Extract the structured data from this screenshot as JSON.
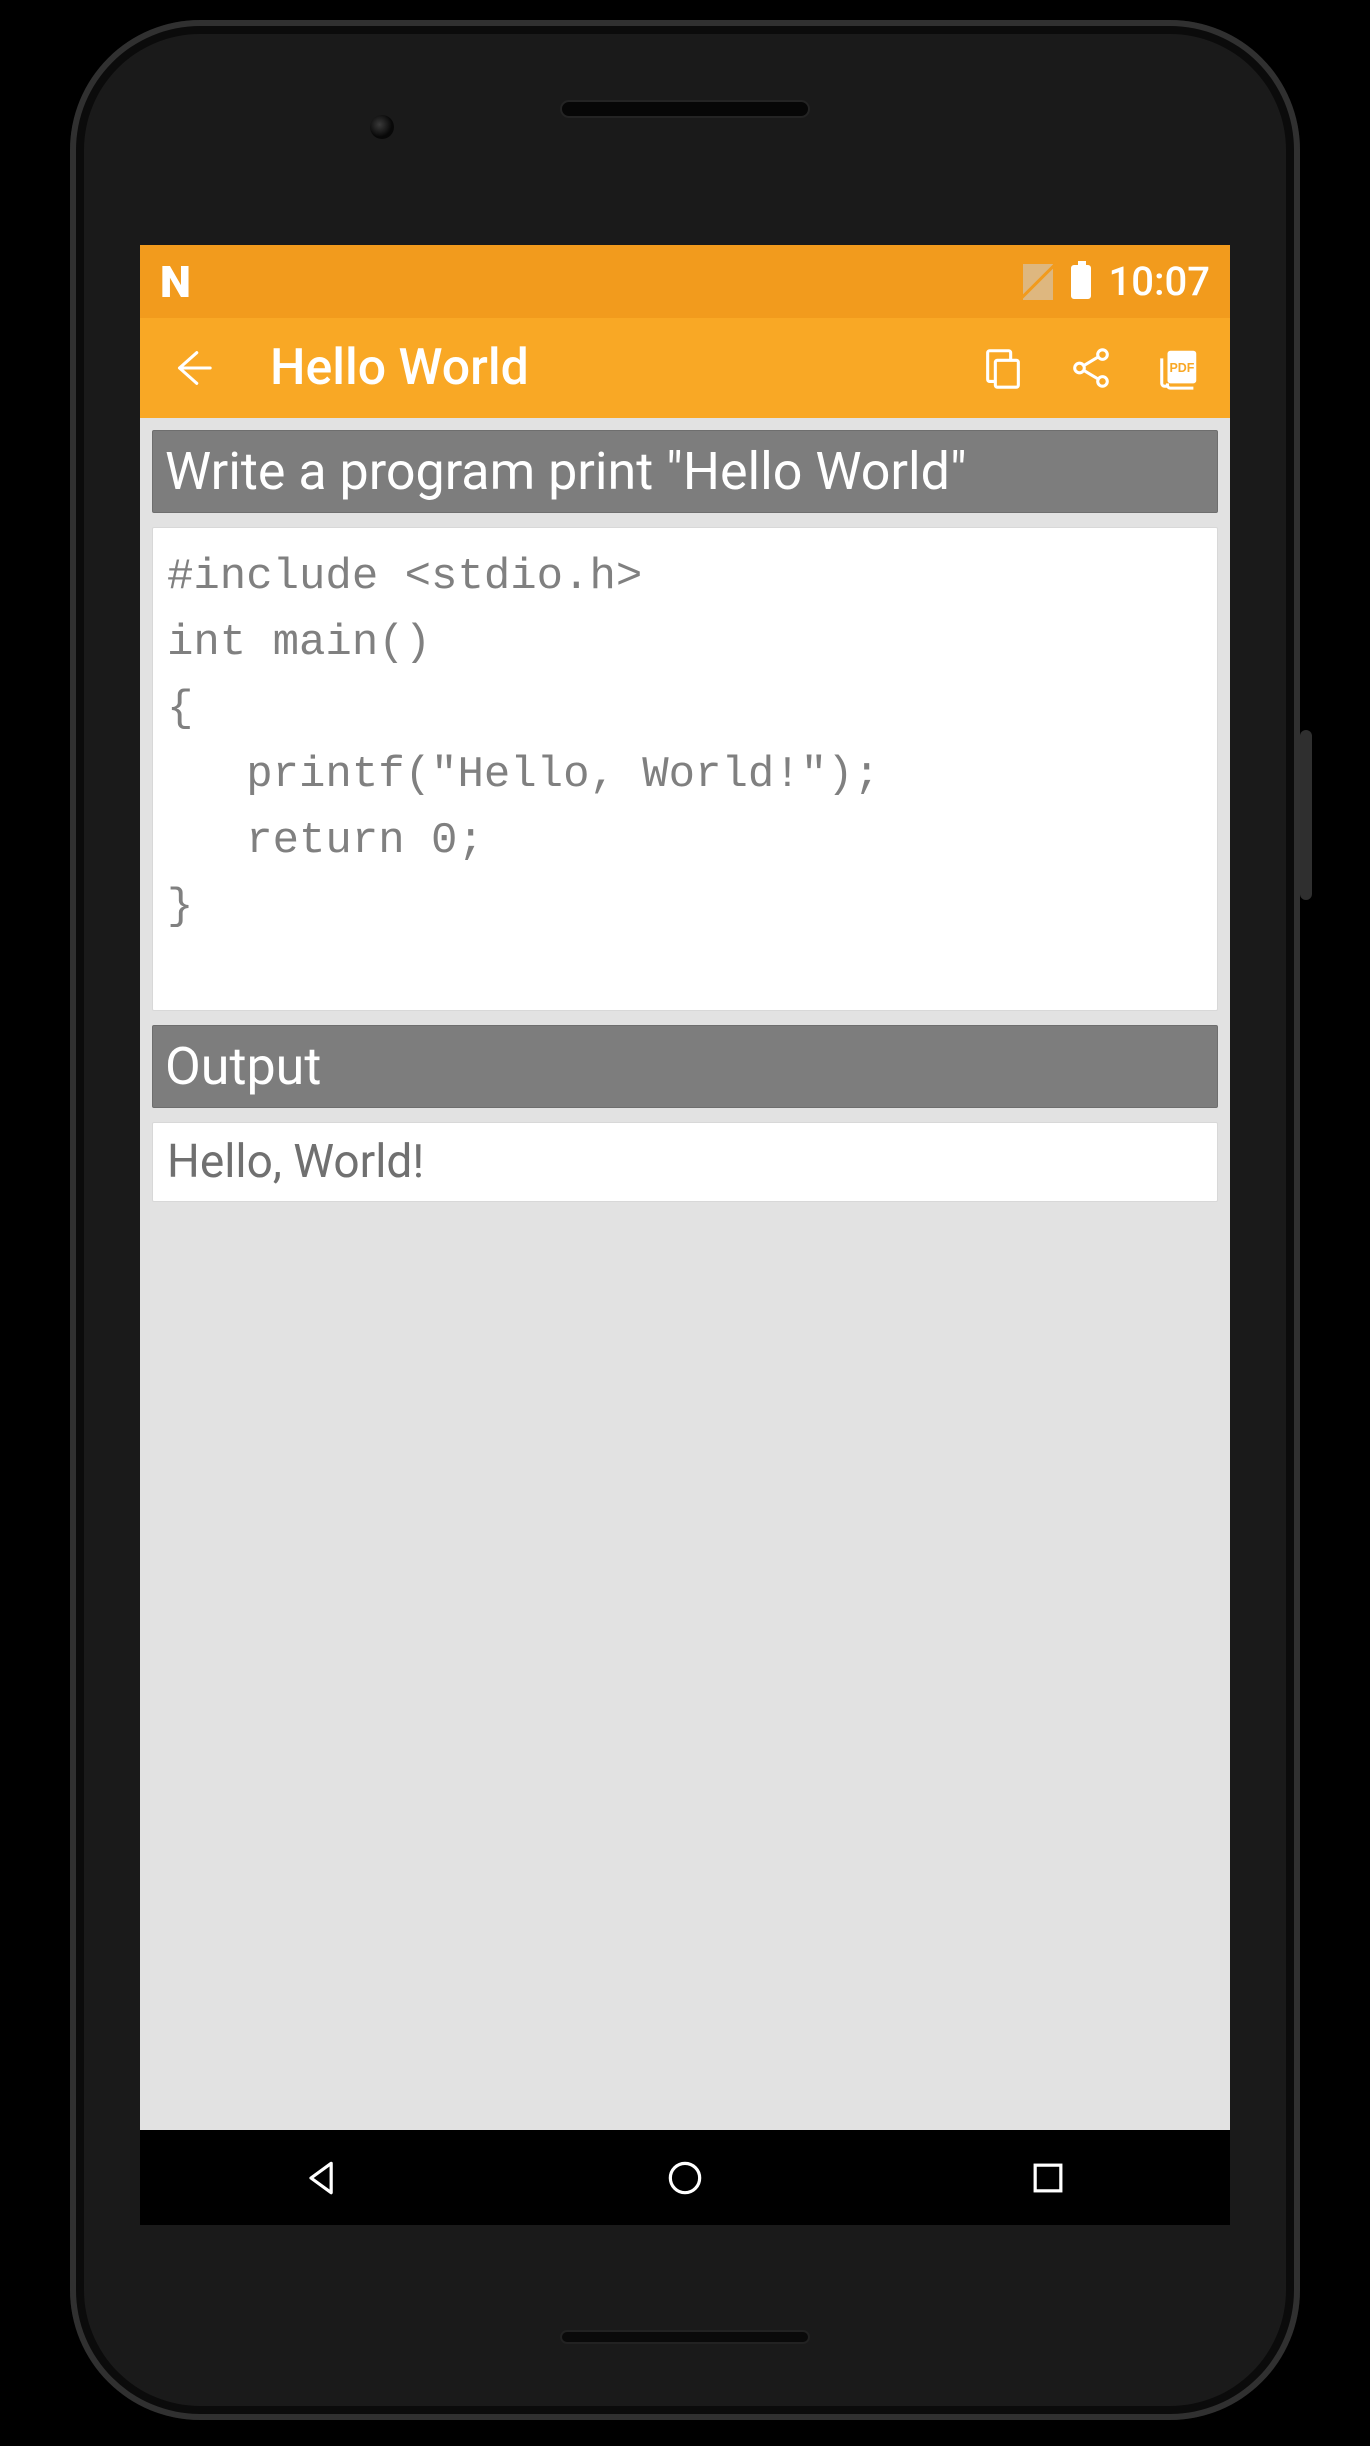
{
  "status": {
    "time": "10:07"
  },
  "appbar": {
    "title": "Hello World"
  },
  "problem": {
    "header": "Write a program print \"Hello World\"",
    "code": "#include <stdio.h>\nint main()\n{\n   printf(\"Hello, World!\");\n   return 0;\n}"
  },
  "output": {
    "header": "Output",
    "text": "Hello, World!"
  }
}
